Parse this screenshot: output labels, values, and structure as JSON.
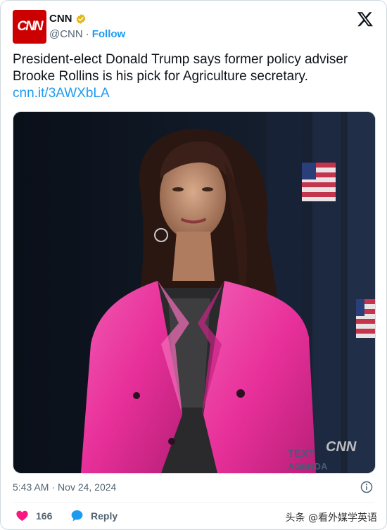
{
  "account": {
    "avatar_text": "CNN",
    "display_name": "CNN",
    "handle": "@CNN",
    "separator": "·",
    "follow_label": "Follow"
  },
  "tweet": {
    "text": "President-elect Donald Trump says former policy adviser Brooke Rollins is his pick for Agriculture secretary.",
    "link": "cnn.it/3AWXbLA"
  },
  "photo": {
    "watermark_text": "CNN",
    "backdrop_text_1": "TEXT",
    "backdrop_text_2": "AGENDA"
  },
  "meta": {
    "time": "5:43 AM",
    "separator": "·",
    "date": "Nov 24, 2024"
  },
  "actions": {
    "like_count": "166",
    "reply_label": "Reply"
  },
  "watermark": "头条 @看外媒学英语",
  "colors": {
    "accent": "#1d9bf0",
    "like": "#f91880",
    "brand": "#cc0000",
    "verified": "#e2b719",
    "blazer": "#e8309a"
  },
  "icons": [
    "verified-badge-icon",
    "x-logo-icon",
    "info-icon",
    "heart-icon",
    "reply-bubble-icon"
  ]
}
